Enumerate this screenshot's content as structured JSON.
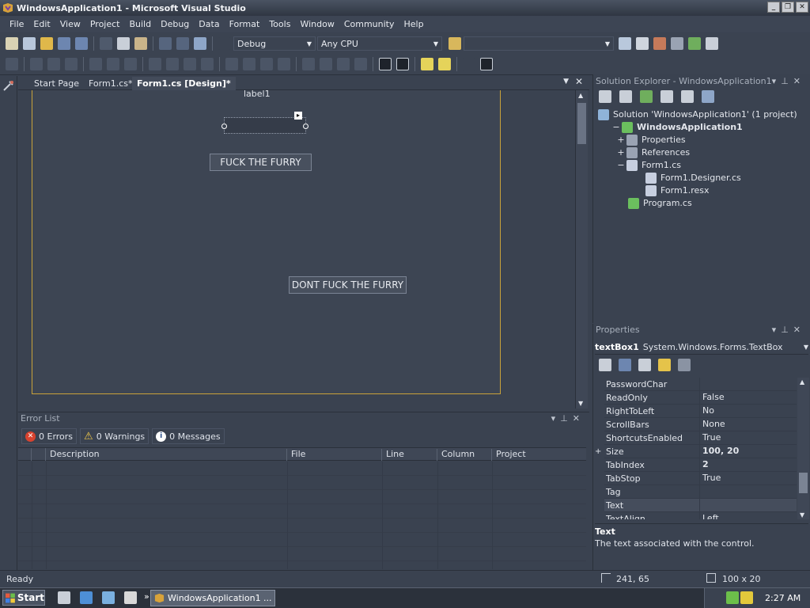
{
  "window": {
    "title": "WindowsApplication1 - Microsoft Visual Studio",
    "controls": [
      "_",
      "❐",
      "✕"
    ]
  },
  "menu": [
    "File",
    "Edit",
    "View",
    "Project",
    "Build",
    "Debug",
    "Data",
    "Format",
    "Tools",
    "Window",
    "Community",
    "Help"
  ],
  "toolbar": {
    "config": "Debug",
    "platform": "Any CPU"
  },
  "doc_tabs": [
    "Start Page",
    "Form1.cs*",
    "Form1.cs [Design]*"
  ],
  "form": {
    "label": "label1",
    "button1": "FUCK THE FURRY",
    "button2": "DONT FUCK THE FURRY"
  },
  "error_list": {
    "title": "Error List",
    "errors": "0 Errors",
    "warnings": "0 Warnings",
    "messages": "0 Messages",
    "columns": [
      "Description",
      "File",
      "Line",
      "Column",
      "Project"
    ]
  },
  "solution_explorer": {
    "title": "Solution Explorer - WindowsApplication1",
    "items": [
      {
        "text": "Solution 'WindowsApplication1' (1 project)",
        "expander": "",
        "bold": false,
        "indent": 0,
        "color": "#8fb3d9"
      },
      {
        "text": "WindowsApplication1",
        "expander": "−",
        "bold": true,
        "indent": 1,
        "color": "#6bbf5e"
      },
      {
        "text": "Properties",
        "expander": "+",
        "bold": false,
        "indent": 2,
        "color": "#9aa3b3"
      },
      {
        "text": "References",
        "expander": "+",
        "bold": false,
        "indent": 2,
        "color": "#9aa3b3"
      },
      {
        "text": "Form1.cs",
        "expander": "−",
        "bold": false,
        "indent": 2,
        "color": "#c7cfe0"
      },
      {
        "text": "Form1.Designer.cs",
        "expander": "",
        "bold": false,
        "indent": 3,
        "color": "#c7cfe0"
      },
      {
        "text": "Form1.resx",
        "expander": "",
        "bold": false,
        "indent": 3,
        "color": "#c7cfe0"
      },
      {
        "text": "Program.cs",
        "expander": "",
        "bold": false,
        "indent": 2,
        "color": "#6bbf5e"
      }
    ]
  },
  "properties": {
    "title": "Properties",
    "object": "textBox1",
    "object_type": "System.Windows.Forms.TextBox",
    "rows": [
      {
        "name": "PasswordChar",
        "value": "",
        "expander": "",
        "bold": false
      },
      {
        "name": "ReadOnly",
        "value": "False",
        "expander": "",
        "bold": false
      },
      {
        "name": "RightToLeft",
        "value": "No",
        "expander": "",
        "bold": false
      },
      {
        "name": "ScrollBars",
        "value": "None",
        "expander": "",
        "bold": false
      },
      {
        "name": "ShortcutsEnabled",
        "value": "True",
        "expander": "",
        "bold": false
      },
      {
        "name": "Size",
        "value": "100, 20",
        "expander": "+",
        "bold": true
      },
      {
        "name": "TabIndex",
        "value": "2",
        "expander": "",
        "bold": true
      },
      {
        "name": "TabStop",
        "value": "True",
        "expander": "",
        "bold": false
      },
      {
        "name": "Tag",
        "value": "",
        "expander": "",
        "bold": false
      },
      {
        "name": "Text",
        "value": "",
        "expander": "",
        "bold": false
      },
      {
        "name": "TextAlign",
        "value": "Left",
        "expander": "",
        "bold": false
      }
    ],
    "desc_title": "Text",
    "desc_text": "The text associated with the control."
  },
  "status": {
    "text": "Ready",
    "position": "241, 65",
    "size": "100 x 20"
  },
  "taskbar": {
    "start": "Start",
    "task": "WindowsApplication1 ...",
    "clock": "2:27 AM",
    "more": "»"
  }
}
